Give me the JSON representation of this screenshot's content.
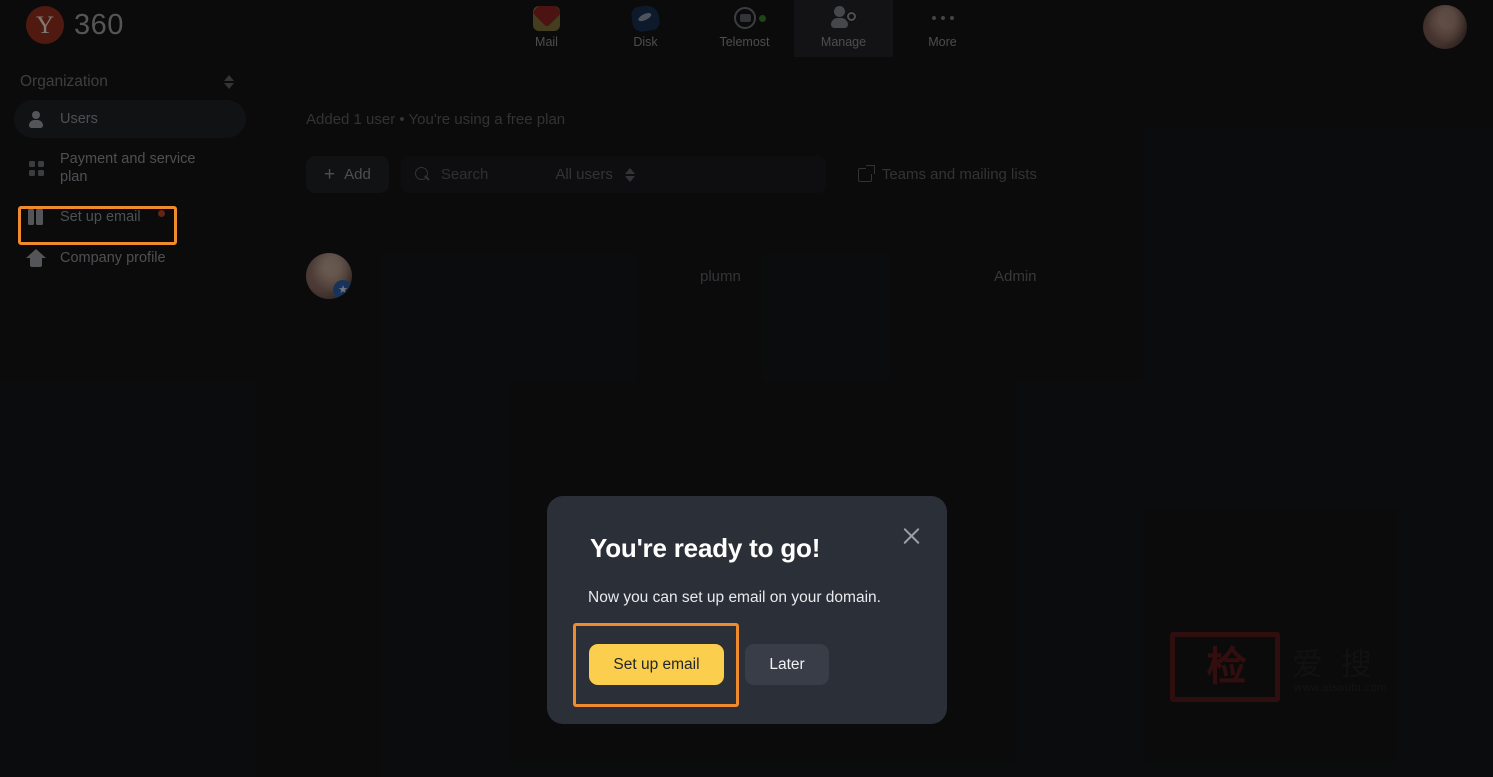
{
  "brand": {
    "logo_letter": "Y",
    "name": "360"
  },
  "topnav": {
    "items": [
      {
        "label": "Mail",
        "icon": "mail-icon"
      },
      {
        "label": "Disk",
        "icon": "disk-icon"
      },
      {
        "label": "Telemost",
        "icon": "telemost-icon"
      },
      {
        "label": "Manage",
        "icon": "manage-icon"
      },
      {
        "label": "More",
        "icon": "more-icon"
      }
    ],
    "active": "Manage"
  },
  "sidebar": {
    "org_label": "Organization",
    "items": [
      {
        "label": "Users",
        "icon": "user-icon",
        "selected": true
      },
      {
        "label": "Payment and service plan",
        "icon": "grid-icon",
        "selected": false
      },
      {
        "label": "Set up email",
        "icon": "building-icon",
        "selected": false,
        "badge": true
      },
      {
        "label": "Company profile",
        "icon": "home-icon",
        "selected": false
      }
    ]
  },
  "main": {
    "plan_note": "Added 1 user • You're using a free plan",
    "toolbar": {
      "add_label": "Add",
      "search_placeholder": "Search",
      "filter_value": "All users",
      "teams_link": "Teams and mailing lists"
    },
    "table": {
      "rows": [
        {
          "name": "plumn",
          "role": "Admin"
        }
      ]
    }
  },
  "modal": {
    "title": "You're ready to go!",
    "body": "Now you can set up email on your domain.",
    "primary_label": "Set up email",
    "secondary_label": "Later",
    "close_icon": "close-icon"
  },
  "watermark": {
    "seal_text": "检",
    "chars": "爱 搜",
    "url": "www.aisoutu.com",
    "url_suffix": "●"
  },
  "colors": {
    "accent_yellow": "#fbcf4d",
    "highlight_orange": "#ef8b2c",
    "brand_red": "#93301f",
    "modal_bg": "#2b2f38",
    "badge_red": "#b2462c"
  }
}
